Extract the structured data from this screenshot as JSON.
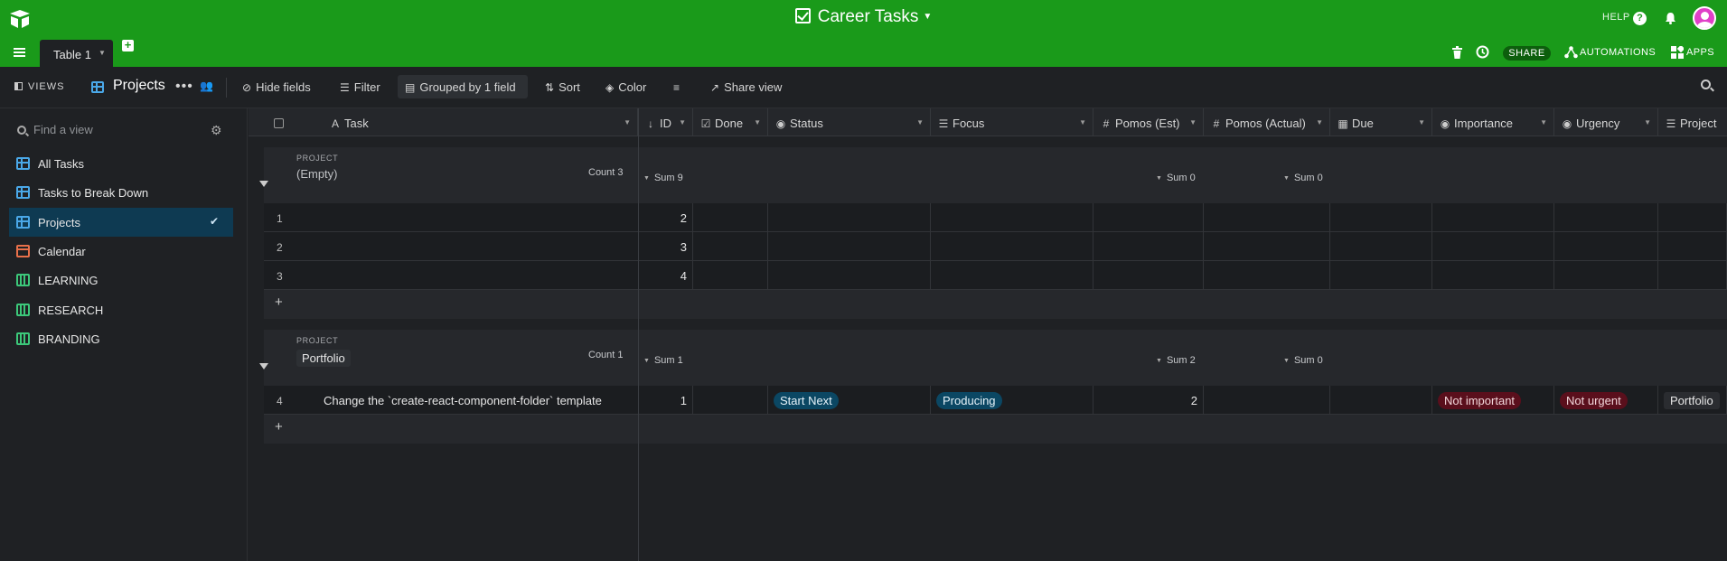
{
  "topbar": {
    "title": "Career Tasks",
    "help": "HELP",
    "table_tab": "Table 1",
    "share": "SHARE",
    "automations": "AUTOMATIONS",
    "apps": "APPS",
    "brand_color": "#1a9a1a"
  },
  "toolbar": {
    "views_label": "VIEWS",
    "current_view": "Projects",
    "hide_fields": "Hide fields",
    "filter": "Filter",
    "grouped": "Grouped by 1 field",
    "sort": "Sort",
    "color": "Color",
    "share_view": "Share view"
  },
  "sidebar": {
    "find_placeholder": "Find a view",
    "views": [
      {
        "label": "All Tasks",
        "type": "grid"
      },
      {
        "label": "Tasks to Break Down",
        "type": "grid"
      },
      {
        "label": "Projects",
        "type": "grid",
        "selected": true
      },
      {
        "label": "Calendar",
        "type": "calendar"
      },
      {
        "label": "LEARNING",
        "type": "kanban"
      },
      {
        "label": "RESEARCH",
        "type": "kanban"
      },
      {
        "label": "BRANDING",
        "type": "kanban"
      }
    ]
  },
  "columns": {
    "task": "Task",
    "id": "ID",
    "done": "Done",
    "status": "Status",
    "focus": "Focus",
    "pomos_est": "Pomos (Est)",
    "pomos_actual": "Pomos (Actual)",
    "due": "Due",
    "importance": "Importance",
    "urgency": "Urgency",
    "project": "Project"
  },
  "groups": [
    {
      "field_label": "PROJECT",
      "name": "(Empty)",
      "count": "Count 3",
      "sum_id": "Sum 9",
      "sum_est": "Sum 0",
      "sum_actual": "Sum 0",
      "rows": [
        {
          "num": "1",
          "task": "",
          "id": "2",
          "status": "",
          "focus": "",
          "est": "",
          "importance": "",
          "urgency": "",
          "project": ""
        },
        {
          "num": "2",
          "task": "",
          "id": "3",
          "status": "",
          "focus": "",
          "est": "",
          "importance": "",
          "urgency": "",
          "project": ""
        },
        {
          "num": "3",
          "task": "",
          "id": "4",
          "status": "",
          "focus": "",
          "est": "",
          "importance": "",
          "urgency": "",
          "project": ""
        }
      ]
    },
    {
      "field_label": "PROJECT",
      "name": "Portfolio",
      "count": "Count 1",
      "sum_id": "Sum 1",
      "sum_est": "Sum 2",
      "sum_actual": "Sum 0",
      "rows": [
        {
          "num": "4",
          "task": "Change the `create-react-component-folder` template",
          "id": "1",
          "status": "Start Next",
          "focus": "Producing",
          "est": "2",
          "importance": "Not important",
          "urgency": "Not urgent",
          "project": "Portfolio"
        }
      ]
    }
  ]
}
